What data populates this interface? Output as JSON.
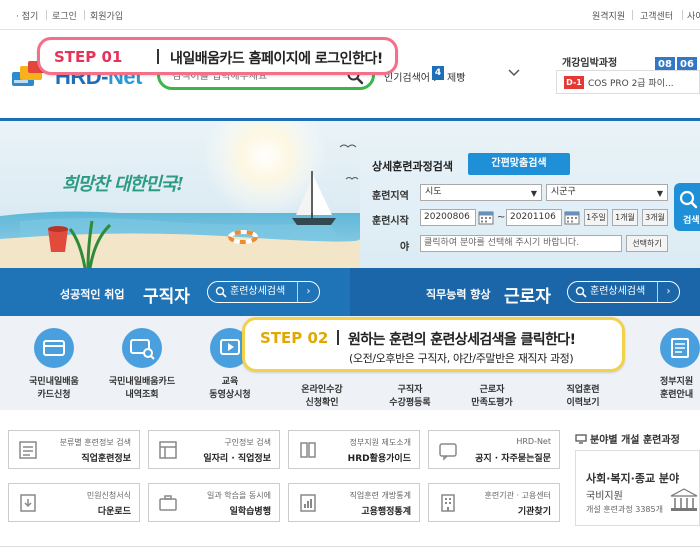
{
  "utility_nav": {
    "left": [
      "· 접기",
      "로그인",
      "회원가입"
    ],
    "right": [
      "원격지원",
      "고객센터",
      "사이"
    ]
  },
  "logo": {
    "prefix": "HRD-",
    "suffix": "Net"
  },
  "search": {
    "placeholder": "검색어를 입력해주세요"
  },
  "popular": {
    "label": "인기검색어 :",
    "rank": "4",
    "keyword": "제빵"
  },
  "upcoming": {
    "title": "개강임박과정",
    "dates": [
      "08",
      "06"
    ],
    "dday": "D-1",
    "course": "COS PRO 2급 파이..."
  },
  "step1": {
    "tag": "STEP 01",
    "message": "내일배움카드 홈페이지에 로그인한다!"
  },
  "step2": {
    "tag": "STEP 02",
    "message": "원하는 훈련의 훈련상세검색을 클릭한다!",
    "sub": "(오전/오후반은 구직자, 야간/주말반은 재직자 과정)"
  },
  "hero": {
    "slogan": "희망찬 대한민국!",
    "form_title": "상세훈련과정검색",
    "quick_search": "간편맞춤검색",
    "region_label": "훈련지역",
    "region_sido": "시도",
    "region_sigungu": "시군구",
    "period_label": "훈련시작",
    "date_from": "20200806",
    "date_sep": "~",
    "date_to": "20201106",
    "periods": [
      "1주일",
      "1개월",
      "3개월"
    ],
    "field_label": "야",
    "field_placeholder": "클릭하여 분야를 선택해 주시기 바랍니다.",
    "field_button": "선택하기",
    "search_button": "검색"
  },
  "band": {
    "left_small": "성공적인 취업",
    "left_large": "구직자",
    "left_button": "훈련상세검색",
    "right_small": "직무능력 향상",
    "right_large": "근로자",
    "right_button": "훈련상세검색"
  },
  "quick_menu": [
    {
      "line1": "국민내일배움",
      "line2": "카드신청"
    },
    {
      "line1": "국민내일배움카드",
      "line2": "내역조회"
    },
    {
      "line1": "교육",
      "line2": "동영상시청"
    },
    {
      "line1": "온라인수강",
      "line2": "신청확인"
    },
    {
      "line1": "구직자",
      "line2": "수강평등록"
    },
    {
      "line1": "근로자",
      "line2": "만족도평가"
    },
    {
      "line1": "직업훈련",
      "line2": "이력보기"
    },
    {
      "line1": "정부지원",
      "line2": "훈련안내"
    }
  ],
  "cards": [
    {
      "top": "분류별 훈련정보 검색",
      "bottom": "직업훈련정보"
    },
    {
      "top": "구인정보 검색",
      "bottom": "일자리 · 직업정보"
    },
    {
      "top": "정부지원 제도소개",
      "bottom": "HRD활용가이드"
    },
    {
      "top": "HRD-Net",
      "bottom": "공지 · 자주묻는질문"
    },
    {
      "top": "민원신청서식",
      "bottom": "다운로드"
    },
    {
      "top": "일과 학습을 동시에",
      "bottom": "일학습병행"
    },
    {
      "top": "직업훈련 개방통계",
      "bottom": "고용행정통계"
    },
    {
      "top": "훈련기관 · 고용센터",
      "bottom": "기관찾기"
    }
  ],
  "category": {
    "title": "분야별 개설 훈련과정",
    "name": "사회·복지·종교 분야",
    "sub": "국비지원",
    "count": "개설 훈련과정 3385개"
  },
  "colors": {
    "primary": "#1d6fb8",
    "green": "#3cb54a",
    "step1": "#f46f8a",
    "step2": "#f2d14b"
  }
}
